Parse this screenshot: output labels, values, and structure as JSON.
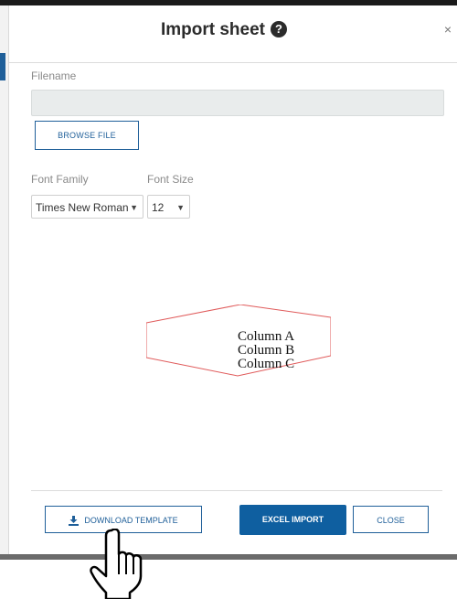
{
  "modal": {
    "title": "Import sheet",
    "help_icon": "question-circle-icon",
    "close_icon": "close-icon",
    "close_glyph": "×"
  },
  "filename": {
    "label": "Filename",
    "value": "",
    "placeholder": ""
  },
  "browse_button": {
    "label": "BROWSE FILE"
  },
  "font_family": {
    "label": "Font Family",
    "selected": "Times New Roman"
  },
  "font_size": {
    "label": "Font Size",
    "selected": "12"
  },
  "preview": {
    "lines": [
      "Column A",
      "Column B",
      "Column C"
    ],
    "outline_color": "#e05a5a"
  },
  "footer": {
    "download_label": "DOWNLOAD TEMPLATE",
    "download_icon": "download-icon",
    "excel_import_label": "EXCEL IMPORT",
    "close_label": "CLOSE"
  },
  "colors": {
    "primary": "#0f5fa0",
    "accent_border": "#1f5f99"
  }
}
